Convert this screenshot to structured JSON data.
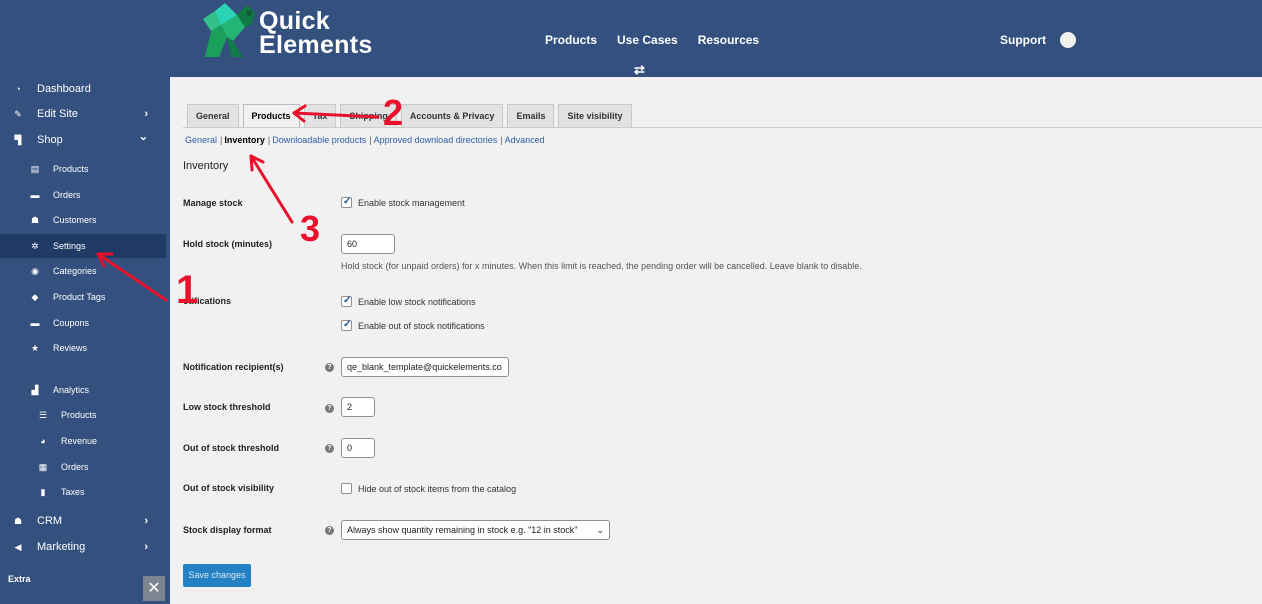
{
  "header": {
    "logo_line1": "Quick",
    "logo_line2": "Elements",
    "nav": [
      "Products",
      "Use Cases",
      "Resources"
    ],
    "swap_icon": "⇄",
    "support": "Support"
  },
  "sidebar": {
    "items": [
      {
        "label": "Dashboard",
        "icon": "gauge-icon"
      },
      {
        "label": "Edit Site",
        "icon": "edit-icon",
        "chevron": "›"
      },
      {
        "label": "Shop",
        "icon": "cart-icon",
        "chevron": "⌄"
      },
      {
        "label": "Products",
        "icon": "store-icon"
      },
      {
        "label": "Orders",
        "icon": "orders-icon"
      },
      {
        "label": "Customers",
        "icon": "users-icon"
      },
      {
        "label": "Settings",
        "icon": "gear-icon"
      },
      {
        "label": "Categories",
        "icon": "categories-icon"
      },
      {
        "label": "Product Tags",
        "icon": "tag-icon"
      },
      {
        "label": "Coupons",
        "icon": "coupon-icon"
      },
      {
        "label": "Reviews",
        "icon": "star-icon"
      },
      {
        "label": "Analytics",
        "icon": "chart-icon"
      },
      {
        "label": "Products",
        "icon": "list-icon"
      },
      {
        "label": "Revenue",
        "icon": "pie-icon"
      },
      {
        "label": "Orders",
        "icon": "table-icon"
      },
      {
        "label": "Taxes",
        "icon": "doc-icon"
      },
      {
        "label": "CRM",
        "icon": "users-icon",
        "chevron": "›"
      },
      {
        "label": "Marketing",
        "icon": "megaphone-icon",
        "chevron": "›"
      }
    ],
    "extra": "Extra",
    "close": "✕"
  },
  "tabs": [
    "General",
    "Products",
    "Tax",
    "Shipping",
    "Accounts & Privacy",
    "Emails",
    "Site visibility"
  ],
  "subnav": {
    "general": "General",
    "inventory": "Inventory",
    "downloadable": "Downloadable products",
    "approved": "Approved download directories",
    "advanced": "Advanced",
    "sep": "|"
  },
  "section_title": "Inventory",
  "form": {
    "manage_stock_label": "Manage stock",
    "manage_stock_check": "Enable stock management",
    "hold_stock_label": "Hold stock (minutes)",
    "hold_stock_value": "60",
    "hold_stock_desc": "Hold stock (for unpaid orders) for x minutes. When this limit is reached, the pending order will be cancelled. Leave blank to disable.",
    "notifications_label": "otifications",
    "low_stock_notif": "Enable low stock notifications",
    "out_stock_notif": "Enable out of stock notifications",
    "recipient_label": "Notification recipient(s)",
    "recipient_value": "qe_blank_template@quickelements.co",
    "low_threshold_label": "Low stock threshold",
    "low_threshold_value": "2",
    "out_threshold_label": "Out of stock threshold",
    "out_threshold_value": "0",
    "visibility_label": "Out of stock visibility",
    "visibility_check": "Hide out of stock items from the catalog",
    "display_format_label": "Stock display format",
    "display_format_value": "Always show quantity remaining in stock e.g. \"12 in stock\"",
    "help_icon": "?",
    "save_button": "Save changes"
  },
  "annotations": {
    "n1": "1",
    "n2": "2",
    "n3": "3"
  },
  "colors": {
    "header_bg": "#34507e",
    "annotation": "#e8102a",
    "primary_button": "#2481c4"
  }
}
